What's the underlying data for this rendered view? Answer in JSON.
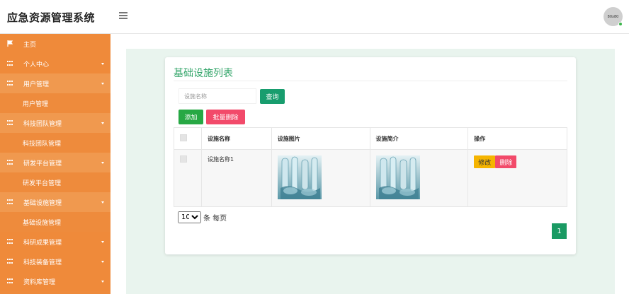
{
  "header": {
    "brand": "应急资源管理系统",
    "avatar_text": "80x80"
  },
  "sidebar": {
    "items": [
      {
        "label": "主页",
        "type": "parent",
        "icon": "flag-icon"
      },
      {
        "label": "个人中心",
        "type": "parent",
        "icon": "grid-icon"
      },
      {
        "label": "用户管理",
        "type": "parent",
        "icon": "grid-icon",
        "open": true
      },
      {
        "label": "用户管理",
        "type": "child"
      },
      {
        "label": "科技团队管理",
        "type": "parent",
        "icon": "grid-icon",
        "open": true
      },
      {
        "label": "科技团队管理",
        "type": "child"
      },
      {
        "label": "研发平台管理",
        "type": "parent",
        "icon": "grid-icon",
        "open": true
      },
      {
        "label": "研发平台管理",
        "type": "child"
      },
      {
        "label": "基础设施管理",
        "type": "parent",
        "icon": "grid-icon",
        "open": true
      },
      {
        "label": "基础设施管理",
        "type": "child"
      },
      {
        "label": "科研成果管理",
        "type": "parent",
        "icon": "grid-icon"
      },
      {
        "label": "科技装备管理",
        "type": "parent",
        "icon": "grid-icon"
      },
      {
        "label": "资料库管理",
        "type": "parent",
        "icon": "grid-icon"
      }
    ]
  },
  "main": {
    "title": "基础设施列表",
    "search": {
      "placeholder": "设施名称",
      "query_label": "查询"
    },
    "actions": {
      "add_label": "添加",
      "batch_delete_label": "批量删除"
    },
    "table": {
      "headers": [
        "设施名称",
        "设施图片",
        "设施简介",
        "操作"
      ],
      "rows": [
        {
          "name": "设施名称1",
          "edit_label": "修改",
          "delete_label": "删除"
        }
      ]
    },
    "pagination": {
      "page_size": "10",
      "page_size_options": [
        "10"
      ],
      "page_size_suffix": "条 每页",
      "current_page": "1"
    }
  },
  "colors": {
    "sidebar": "#ee8b3c",
    "accent_green": "#189d6e",
    "danger": "#f24a6a",
    "warning": "#f5b400"
  }
}
